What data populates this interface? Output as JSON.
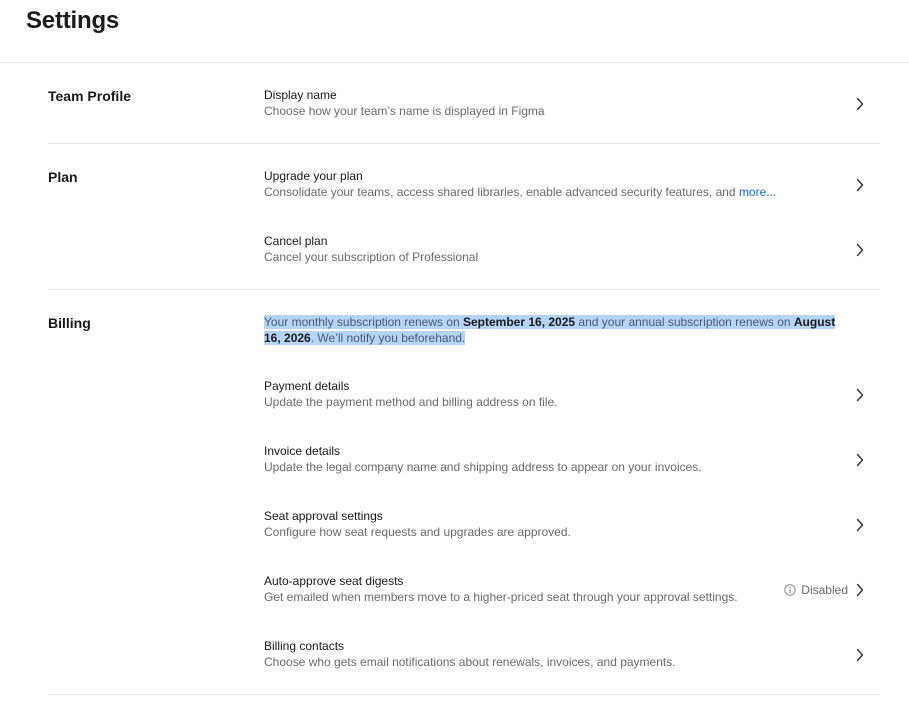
{
  "header": {
    "title": "Settings"
  },
  "sections": {
    "team_profile": {
      "label": "Team Profile",
      "display_name": {
        "title": "Display name",
        "description": "Choose how your team’s name is displayed in Figma"
      }
    },
    "plan": {
      "label": "Plan",
      "upgrade": {
        "title": "Upgrade your plan",
        "description": "Consolidate your teams, access shared libraries, enable advanced security features, and ",
        "more_link": "more..."
      },
      "cancel": {
        "title": "Cancel plan",
        "description": "Cancel your subscription of Professional"
      }
    },
    "billing": {
      "label": "Billing",
      "renewal_note": {
        "part1": "Your monthly subscription renews on ",
        "monthly_date": "September 16, 2025",
        "part2": " and your annual subscription renews on ",
        "annual_date": "August 16, 2026",
        "part3": ". We’ll notify you beforehand."
      },
      "payment_details": {
        "title": "Payment details",
        "description": "Update the payment method and billing address on file."
      },
      "invoice_details": {
        "title": "Invoice details",
        "description": "Update the legal company name and shipping address to appear on your invoices."
      },
      "seat_approval": {
        "title": "Seat approval settings",
        "description": "Configure how seat requests and upgrades are approved."
      },
      "auto_approve": {
        "title": "Auto-approve seat digests",
        "description": "Get emailed when members move to a higher-priced seat through your approval settings.",
        "status": "Disabled"
      },
      "billing_contacts": {
        "title": "Billing contacts",
        "description": "Choose who gets email notifications about renewals, invoices, and payments."
      }
    }
  },
  "icons": {
    "chevron": "chevron-right-icon",
    "info": "info-icon"
  },
  "colors": {
    "link": "#0d6fd8",
    "selection_highlight": "#b4d5f8",
    "divider": "#e6e6e6",
    "muted_text": "#6b6b6b"
  }
}
